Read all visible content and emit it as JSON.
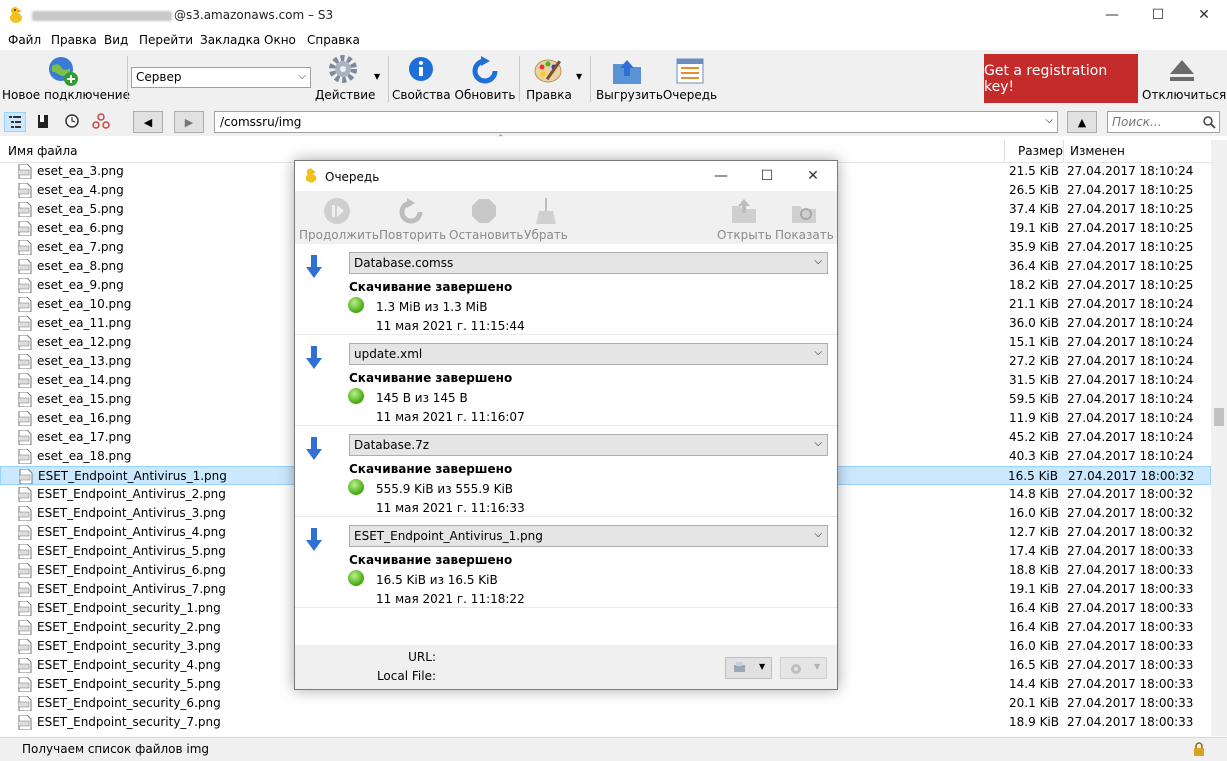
{
  "window": {
    "title_suffix": "@s3.amazonaws.com – S3",
    "minimize": "—",
    "maximize": "☐",
    "close": "✕"
  },
  "menu": [
    "Файл",
    "Правка",
    "Вид",
    "Перейти",
    "Закладка",
    "Окно",
    "Справка"
  ],
  "toolbar": {
    "new_connection": "Новое подключение",
    "server_value": "Сервер",
    "action": "Действие",
    "properties": "Свойства",
    "refresh": "Обновить",
    "edit": "Правка",
    "upload": "Выгрузить",
    "queue": "Очередь",
    "register": "Get a registration key!",
    "disconnect": "Отключиться"
  },
  "pathbar": {
    "back": "◀",
    "forward": "▶",
    "path": "/comssru/img",
    "up": "▲",
    "search_placeholder": "Поиск..."
  },
  "columns": {
    "name": "Имя файла",
    "size": "Размер",
    "modified": "Изменен"
  },
  "files": [
    {
      "name": "eset_ea_3.png",
      "size": "21.5 KiB",
      "date": "27.04.2017 18:10:24"
    },
    {
      "name": "eset_ea_4.png",
      "size": "26.5 KiB",
      "date": "27.04.2017 18:10:25"
    },
    {
      "name": "eset_ea_5.png",
      "size": "37.4 KiB",
      "date": "27.04.2017 18:10:25"
    },
    {
      "name": "eset_ea_6.png",
      "size": "19.1 KiB",
      "date": "27.04.2017 18:10:25"
    },
    {
      "name": "eset_ea_7.png",
      "size": "35.9 KiB",
      "date": "27.04.2017 18:10:25"
    },
    {
      "name": "eset_ea_8.png",
      "size": "36.4 KiB",
      "date": "27.04.2017 18:10:25"
    },
    {
      "name": "eset_ea_9.png",
      "size": "18.2 KiB",
      "date": "27.04.2017 18:10:25"
    },
    {
      "name": "eset_ea_10.png",
      "size": "21.1 KiB",
      "date": "27.04.2017 18:10:24"
    },
    {
      "name": "eset_ea_11.png",
      "size": "36.0 KiB",
      "date": "27.04.2017 18:10:24"
    },
    {
      "name": "eset_ea_12.png",
      "size": "15.1 KiB",
      "date": "27.04.2017 18:10:24"
    },
    {
      "name": "eset_ea_13.png",
      "size": "27.2 KiB",
      "date": "27.04.2017 18:10:24"
    },
    {
      "name": "eset_ea_14.png",
      "size": "31.5 KiB",
      "date": "27.04.2017 18:10:24"
    },
    {
      "name": "eset_ea_15.png",
      "size": "59.5 KiB",
      "date": "27.04.2017 18:10:24"
    },
    {
      "name": "eset_ea_16.png",
      "size": "11.9 KiB",
      "date": "27.04.2017 18:10:24"
    },
    {
      "name": "eset_ea_17.png",
      "size": "45.2 KiB",
      "date": "27.04.2017 18:10:24"
    },
    {
      "name": "eset_ea_18.png",
      "size": "40.3 KiB",
      "date": "27.04.2017 18:10:24"
    },
    {
      "name": "ESET_Endpoint_Antivirus_1.png",
      "size": "16.5 KiB",
      "date": "27.04.2017 18:00:32",
      "selected": true
    },
    {
      "name": "ESET_Endpoint_Antivirus_2.png",
      "size": "14.8 KiB",
      "date": "27.04.2017 18:00:32"
    },
    {
      "name": "ESET_Endpoint_Antivirus_3.png",
      "size": "16.0 KiB",
      "date": "27.04.2017 18:00:32"
    },
    {
      "name": "ESET_Endpoint_Antivirus_4.png",
      "size": "12.7 KiB",
      "date": "27.04.2017 18:00:32"
    },
    {
      "name": "ESET_Endpoint_Antivirus_5.png",
      "size": "17.4 KiB",
      "date": "27.04.2017 18:00:33"
    },
    {
      "name": "ESET_Endpoint_Antivirus_6.png",
      "size": "18.8 KiB",
      "date": "27.04.2017 18:00:33"
    },
    {
      "name": "ESET_Endpoint_Antivirus_7.png",
      "size": "19.1 KiB",
      "date": "27.04.2017 18:00:33"
    },
    {
      "name": "ESET_Endpoint_security_1.png",
      "size": "16.4 KiB",
      "date": "27.04.2017 18:00:33"
    },
    {
      "name": "ESET_Endpoint_security_2.png",
      "size": "16.4 KiB",
      "date": "27.04.2017 18:00:33"
    },
    {
      "name": "ESET_Endpoint_security_3.png",
      "size": "16.0 KiB",
      "date": "27.04.2017 18:00:33"
    },
    {
      "name": "ESET_Endpoint_security_4.png",
      "size": "16.5 KiB",
      "date": "27.04.2017 18:00:33"
    },
    {
      "name": "ESET_Endpoint_security_5.png",
      "size": "14.4 KiB",
      "date": "27.04.2017 18:00:33"
    },
    {
      "name": "ESET_Endpoint_security_6.png",
      "size": "20.1 KiB",
      "date": "27.04.2017 18:00:33"
    },
    {
      "name": "ESET_Endpoint_security_7.png",
      "size": "18.9 KiB",
      "date": "27.04.2017 18:00:33"
    }
  ],
  "status": "Получаем список файлов img",
  "queue": {
    "title": "Очередь",
    "toolbar": {
      "resume": "Продолжить",
      "retry": "Повторить",
      "stop": "Остановить",
      "remove": "Убрать",
      "open": "Открыть",
      "show": "Показать"
    },
    "transfers": [
      {
        "file": "Database.comss",
        "status": "Скачивание завершено",
        "progress": "1.3 MiB из 1.3 MiB",
        "time": "11 мая 2021 г. 11:15:44"
      },
      {
        "file": "update.xml",
        "status": "Скачивание завершено",
        "progress": "145 B из 145 B",
        "time": "11 мая 2021 г. 11:16:07"
      },
      {
        "file": "Database.7z",
        "status": "Скачивание завершено",
        "progress": "555.9 KiB из 555.9 KiB",
        "time": "11 мая 2021 г. 11:16:33"
      },
      {
        "file": "ESET_Endpoint_Antivirus_1.png",
        "status": "Скачивание завершено",
        "progress": "16.5 KiB из 16.5 KiB",
        "time": "11 мая 2021 г. 11:18:22"
      }
    ],
    "url_label": "URL:",
    "local_file_label": "Local File:"
  },
  "colors": {
    "accent_red": "#c42b2b",
    "selection": "#cce8ff",
    "complete_green": "#43a70f",
    "arrow_blue": "#2f6fd6"
  }
}
